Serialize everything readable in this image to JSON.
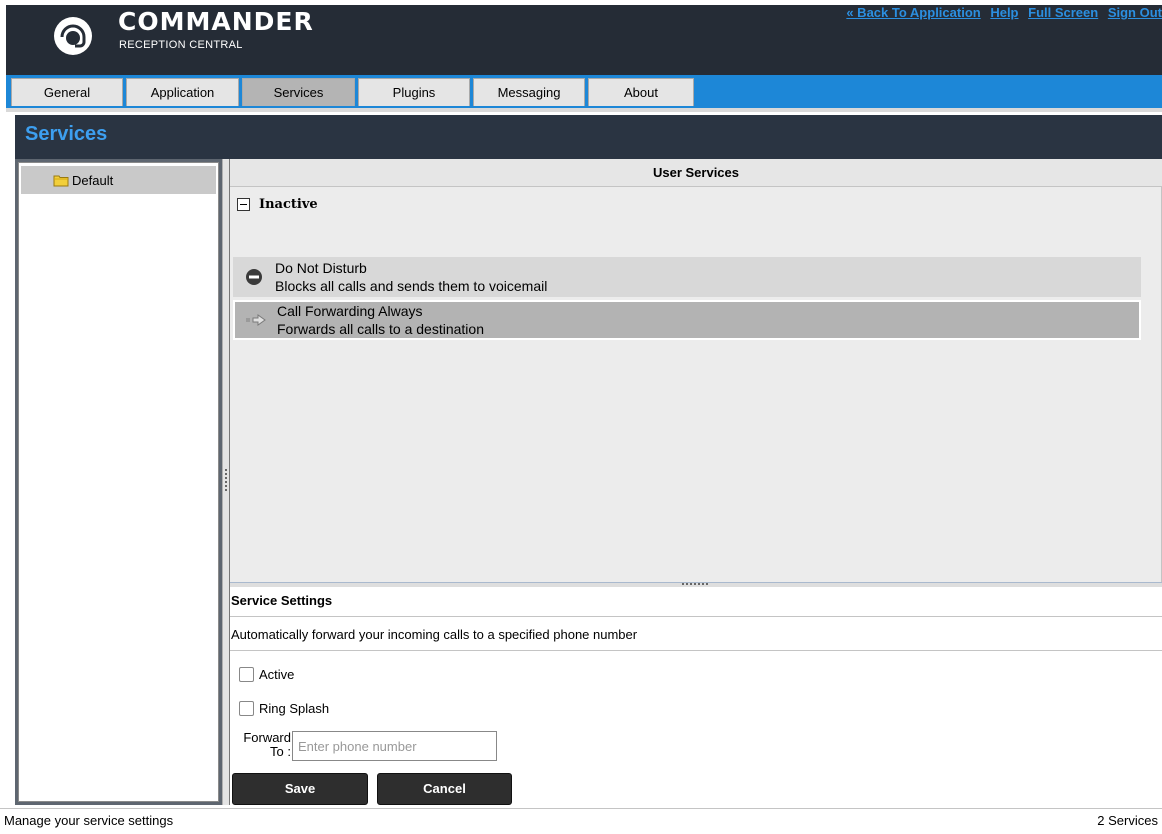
{
  "header": {
    "brand_text": "COMMANDER",
    "brand_sub": "RECEPTION CENTRAL",
    "links": [
      "« Back To Application",
      "Help",
      "Full Screen",
      "Sign Out"
    ]
  },
  "tabs": [
    {
      "label": "General"
    },
    {
      "label": "Application"
    },
    {
      "label": "Services",
      "active": true
    },
    {
      "label": "Plugins"
    },
    {
      "label": "Messaging"
    },
    {
      "label": "About"
    }
  ],
  "section": {
    "title": "Services"
  },
  "tree": {
    "items": [
      {
        "label": "Default"
      }
    ]
  },
  "user_services": {
    "header": "User Services",
    "group_label": "Inactive",
    "services": [
      {
        "name": "Do Not Disturb",
        "description": "Blocks all calls and sends them to voicemail",
        "icon": "do-not-disturb-icon"
      },
      {
        "name": "Call Forwarding Always",
        "description": "Forwards all calls to a destination",
        "icon": "call-forward-icon"
      }
    ]
  },
  "service_settings": {
    "header": "Service Settings",
    "description": "Automatically forward your incoming calls to a specified phone number",
    "active_label": "Active",
    "ring_splash_label": "Ring Splash",
    "forward_label_1": "Forward",
    "forward_label_2": "To :",
    "forward_placeholder": "Enter phone number",
    "save_label": "Save",
    "cancel_label": "Cancel"
  },
  "status": {
    "left": "Manage your service settings",
    "right": "2 Services"
  },
  "colors": {
    "header_bg": "#252c36",
    "tabbar_bg": "#1d87d7",
    "section_title": "#3d9ff0",
    "link": "#2b8fe0"
  }
}
